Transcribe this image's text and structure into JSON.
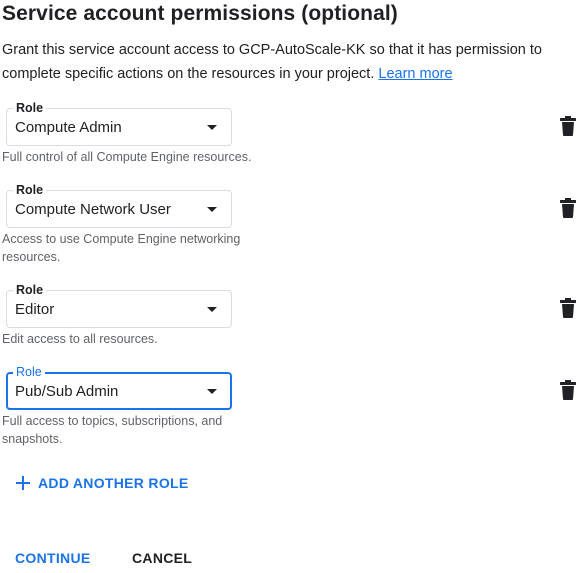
{
  "header": {
    "title": "Service account permissions (optional)",
    "description_text": "Grant this service account access to GCP-AutoScale-KK so that it has permission to complete specific actions on the resources in your project.",
    "learn_more_label": "Learn more"
  },
  "roles": [
    {
      "label": "Role",
      "value": "Compute Admin",
      "helper": "Full control of all Compute Engine resources.",
      "focused": false
    },
    {
      "label": "Role",
      "value": "Compute Network User",
      "helper": "Access to use Compute Engine networking resources.",
      "focused": false
    },
    {
      "label": "Role",
      "value": "Editor",
      "helper": "Edit access to all resources.",
      "focused": false
    },
    {
      "label": "Role",
      "value": "Pub/Sub Admin",
      "helper": "Full access to topics, subscriptions, and snapshots.",
      "focused": true
    }
  ],
  "actions": {
    "add_role_label": "ADD ANOTHER ROLE",
    "continue_label": "CONTINUE",
    "cancel_label": "CANCEL"
  },
  "icons": {
    "dropdown": "caret-down-icon",
    "delete": "trash-icon",
    "add": "plus-icon"
  },
  "colors": {
    "accent": "#1a73e8",
    "text": "#202124",
    "helper_text": "#5f6368",
    "border": "#dadce0"
  }
}
